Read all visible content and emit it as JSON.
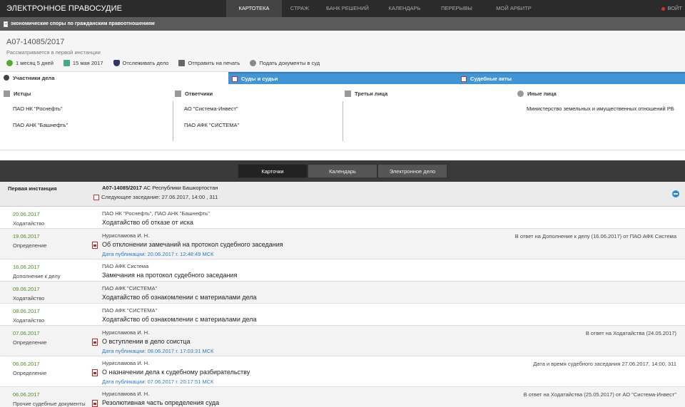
{
  "nav": {
    "brand": "ЭЛЕКТРОННОЕ ПРАВОСУДИЕ",
    "items": [
      "КАРТОТЕКА",
      "СТРАЖ",
      "БАНК РЕШЕНИЙ",
      "КАЛЕНДАРЬ",
      "ПЕРЕРЫВЫ",
      "МОЙ АРБИТР"
    ],
    "active": "КАРТОТЕКА",
    "login": "ВОЙТ"
  },
  "category": "экономические споры по гражданским правоотношениям",
  "case": {
    "number": "А07-14085/2017",
    "status": "Рассматривается в первой инстанции",
    "actions": {
      "duration": "1 месяц 5 дней",
      "date": "15 мая 2017",
      "track": "Отслеживать дело",
      "print": "Отправить на печать",
      "submit": "Подать документы в суд"
    }
  },
  "tabs": {
    "participants": "Участники дела",
    "courts": "Суды и судьи",
    "acts": "Судебные акты"
  },
  "participants": {
    "plaintiffs": {
      "title": "Истцы",
      "items": [
        "ПАО НК \"Роснефть\"",
        "ПАО АНК \"Башнефть\""
      ]
    },
    "defendants": {
      "title": "Ответчики",
      "items": [
        "АО \"Система-Инвест\"",
        "ПАО АФК \"СИСТЕМА\""
      ]
    },
    "third": {
      "title": "Третьи лица",
      "items": []
    },
    "other": {
      "title": "Иные лица",
      "items": [
        "Министерство земельных и имущественных отношений РБ"
      ]
    }
  },
  "viewtabs": {
    "cards": "Карточки",
    "calendar": "Календарь",
    "edoc": "Электронное дело"
  },
  "instance": {
    "label": "Первая инстанция",
    "case_no": "А07-14085/2017",
    "court": " АС Республики Башкортостан",
    "next": "Следующее заседание: 27.06.2017, 14:00 , 311"
  },
  "rows": [
    {
      "date": "20.06.2017",
      "type": "Ходатайство",
      "who": "ПАО НК \"Роснефть\", ПАО АНК \"Башнефть\"",
      "title": "Ходатайство об отказе от иска",
      "pub": "",
      "right": "",
      "pdf": false,
      "gray": false
    },
    {
      "date": "19.06.2017",
      "type": "Определение",
      "who": "Нурисламова И. Н.",
      "title": "Об отклонении замечаний на протокол судебного заседания",
      "pub": "Дата публикации: 20.06.2017 г. 12:48:49 МСК",
      "right": "В ответ на Дополнение к делу (16.06.2017) от ПАО АФК Система",
      "pdf": true,
      "gray": true
    },
    {
      "date": "16.06.2017",
      "type": "Дополнение к делу",
      "who": "ПАО АФК Система",
      "title": "Замечания на протокол судебного заседания",
      "pub": "",
      "right": "",
      "pdf": false,
      "gray": false
    },
    {
      "date": "09.06.2017",
      "type": "Ходатайство",
      "who": "ПАО АФК \"СИСТЕМА\"",
      "title": "Ходатайство об ознакомлении с материалами дела",
      "pub": "",
      "right": "",
      "pdf": false,
      "gray": true
    },
    {
      "date": "08.06.2017",
      "type": "Ходатайство",
      "who": "ПАО АФК \"СИСТЕМА\"",
      "title": "Ходатайство об ознакомлении с материалами дела",
      "pub": "",
      "right": "",
      "pdf": false,
      "gray": false
    },
    {
      "date": "07.06.2017",
      "type": "Определение",
      "who": "Нурисламова И. Н.",
      "title": "О вступлении в дело соистца",
      "pub": "Дата публикации: 08.06.2017 г. 17:03:31 МСК",
      "right": "В ответ на Ходатайства (24.05.2017)",
      "pdf": true,
      "gray": true
    },
    {
      "date": "06.06.2017",
      "type": "Определение",
      "who": "Нурисламова И. Н.",
      "title": "О назначении дела к судебному разбирательству",
      "pub": "Дата публикации: 07.06.2017 г. 20:17:51 МСК",
      "right": "Дата и время судебного заседания 27.06.2017, 14:00, 311",
      "pdf": true,
      "gray": false
    },
    {
      "date": "06.06.2017",
      "type": "Прочие судебные документы",
      "who": "Нурисламова И. Н.",
      "title": "Резолютивная часть определения суда",
      "pub": "Дата публикации: 07.06.2017 г. 12:20:38 МСК",
      "right": "В ответ на Ходатайства (25.05.2017) от АО \"Система-Инвест\"",
      "pdf": true,
      "gray": true
    }
  ]
}
